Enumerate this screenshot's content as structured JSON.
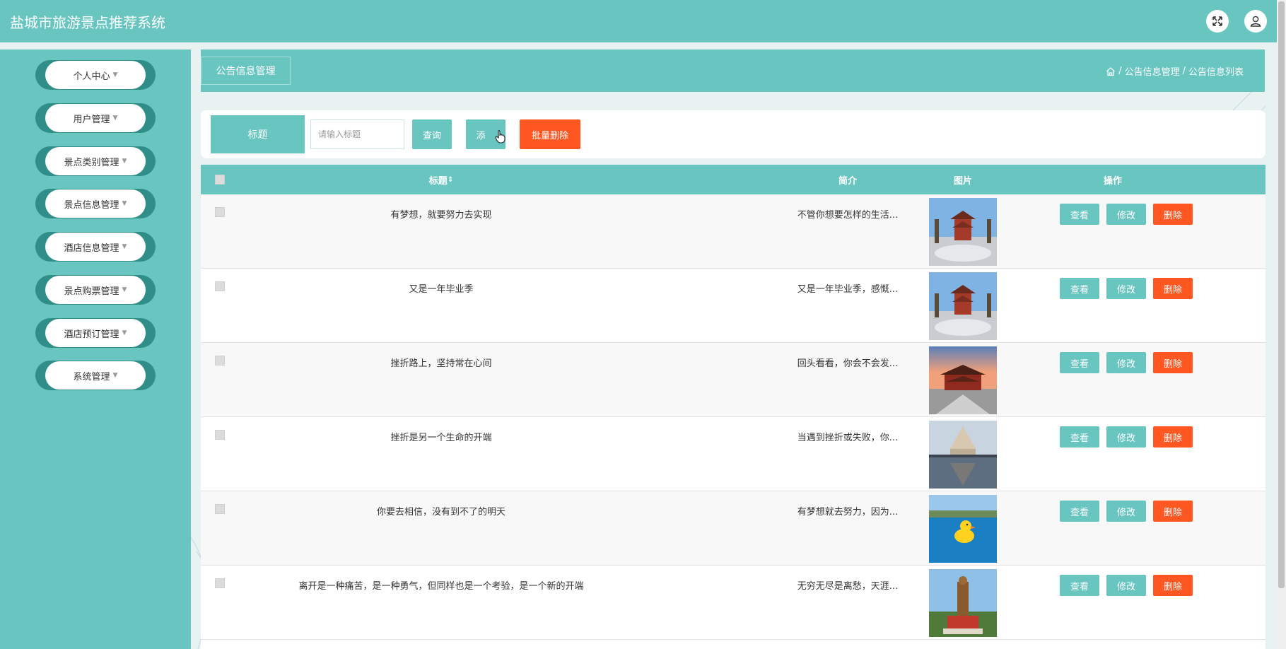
{
  "app": {
    "title": "盐城市旅游景点推荐系统"
  },
  "colors": {
    "primary": "#68c5c0",
    "danger": "#ff5722",
    "sidebar_ring": "#2f8f88"
  },
  "sidebar": {
    "items": [
      {
        "label": "个人中心"
      },
      {
        "label": "用户管理"
      },
      {
        "label": "景点类别管理"
      },
      {
        "label": "景点信息管理"
      },
      {
        "label": "酒店信息管理"
      },
      {
        "label": "景点购票管理"
      },
      {
        "label": "酒店预订管理"
      },
      {
        "label": "系统管理"
      }
    ]
  },
  "page": {
    "title": "公告信息管理",
    "breadcrumb": [
      "公告信息管理",
      "公告信息列表"
    ],
    "breadcrumb_sep": "/"
  },
  "search": {
    "label": "标题",
    "placeholder": "请输入标题",
    "query_button": "查询",
    "add_button": "添",
    "batch_delete_button": "批量删除"
  },
  "table": {
    "columns": {
      "title": "标题",
      "sort_glyph": "⇕",
      "summary": "简介",
      "image": "图片",
      "actions": "操作"
    },
    "action_labels": {
      "view": "查看",
      "edit": "修改",
      "delete": "删除"
    },
    "rows": [
      {
        "title": "有梦想，就要努力去实现",
        "summary": "不管你想要怎样的生活...",
        "image": "temple-pagoda"
      },
      {
        "title": "又是一年毕业季",
        "summary": "又是一年毕业季，感慨...",
        "image": "temple-pagoda"
      },
      {
        "title": "挫折路上，坚持常在心间",
        "summary": "回头看看，你会不会发...",
        "image": "temple-sunset"
      },
      {
        "title": "挫折是另一个生命的开端",
        "summary": "当遇到挫折或失败，你...",
        "image": "pavilion-reflection"
      },
      {
        "title": "你要去相信，没有到不了的明天",
        "summary": "有梦想就去努力，因为...",
        "image": "pool-duck"
      },
      {
        "title": "离开是一种痛苦，是一种勇气，但同样也是一个考验，是一个新的开端",
        "summary": "无穷无尽是离愁，天涯...",
        "image": "buddha-statue"
      }
    ]
  }
}
